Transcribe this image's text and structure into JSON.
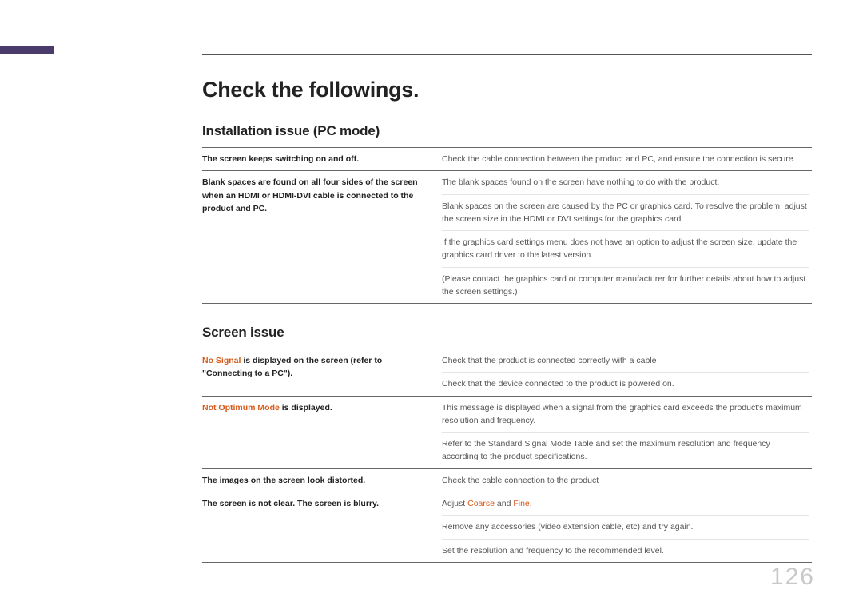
{
  "title": "Check the followings.",
  "pageNumber": "126",
  "sections": [
    {
      "heading": "Installation issue (PC mode)",
      "rows": [
        {
          "left": [
            {
              "t": "The screen keeps switching on and off."
            }
          ],
          "right": [
            {
              "t": "Check the cable connection between the product and PC, and ensure the connection is secure."
            }
          ]
        },
        {
          "left": [
            {
              "t": "Blank spaces are found on all four sides of the screen when an HDMI or HDMI-DVI cable is connected to the product and PC."
            }
          ],
          "right": [
            {
              "t": "The blank spaces found on the screen have nothing to do with the product."
            },
            {
              "t": "Blank spaces on the screen are caused by the PC or graphics card. To resolve the problem, adjust the screen size in the HDMI or DVI settings for the graphics card."
            },
            {
              "t": "If the graphics card settings menu does not have an option to adjust the screen size, update the graphics card driver to the latest version."
            },
            {
              "t": "(Please contact the graphics card or computer manufacturer for further details about how to adjust the screen settings.)"
            }
          ]
        }
      ]
    },
    {
      "heading": "Screen issue",
      "rows": [
        {
          "left": [
            {
              "o": "No Signal",
              "t": " is displayed on the screen (refer to \"Connecting to a PC\")."
            }
          ],
          "right": [
            {
              "t": "Check that the product is connected correctly with a cable"
            },
            {
              "t": "Check that the device connected to the product is powered on."
            }
          ]
        },
        {
          "left": [
            {
              "o": "Not Optimum Mode",
              "t": " is displayed."
            }
          ],
          "right": [
            {
              "t": "This message is displayed when a signal from the graphics card exceeds the product's maximum resolution and frequency."
            },
            {
              "t": "Refer to the Standard Signal Mode Table and set the maximum resolution and frequency according to the product specifications."
            }
          ]
        },
        {
          "left": [
            {
              "t": "The images on the screen look distorted."
            }
          ],
          "right": [
            {
              "t": "Check the cable connection to the product"
            }
          ]
        },
        {
          "left": [
            {
              "t": "The screen is not clear. The screen is blurry."
            }
          ],
          "right": [
            {
              "pre": "Adjust ",
              "o1": "Coarse",
              "mid": " and ",
              "o2": "Fine",
              "post": "."
            },
            {
              "t": "Remove any accessories (video extension cable, etc) and try again."
            },
            {
              "t": "Set the resolution and frequency to the recommended level."
            }
          ]
        }
      ]
    }
  ]
}
